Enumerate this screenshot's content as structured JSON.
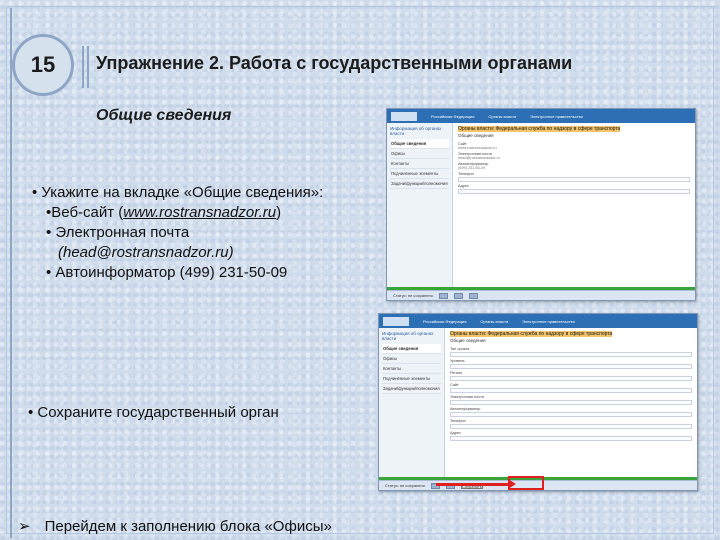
{
  "slide": {
    "number": "15",
    "title": "Упражнение 2. Работа с государственными органами",
    "subtitle": "Общие сведения",
    "bullet_main": "Укажите на вкладке «Общие сведения»:",
    "website_prefix": "Веб-сайт (",
    "website_url": "www.rostransnadzor.ru",
    "website_suffix": ")",
    "email_label": "Электронная почта",
    "email_value": "(head@rostransnadzor.ru)",
    "autoinformer": "Автоинформатор (499) 231-50-09",
    "save_bullet": "Сохраните государственный орган",
    "next_step": "Перейдем к заполнению блока «Офисы»"
  },
  "colors": {
    "accent_border": "#8ea6c6",
    "highlight_red": "#e02020",
    "portal_blue": "#2c6fb5",
    "portal_green": "#3aa33a"
  },
  "screenshot1": {
    "header_menu": [
      "Российская Федерация",
      "Органы власти",
      "Электронное правительство"
    ],
    "sidebar_head": "Информация об органах власти",
    "sidebar_items": [
      "Общие сведения",
      "Офисы",
      "Контакты",
      "Подчинённые элементы",
      "Задачи/функции/полномочия"
    ],
    "heading": "Органы власти: Федеральная служба по надзору в сфере транспорта",
    "tab": "Общие сведения",
    "fields": [
      {
        "label": "Сайт",
        "value": "www.rostransnadzor.ru"
      },
      {
        "label": "Электронная почта",
        "value": "head@rostransnadzor.ru"
      },
      {
        "label": "Автоинформатор",
        "value": "(499) 231-50-09"
      },
      {
        "label": "Телефон",
        "value": ""
      },
      {
        "label": "Адрес",
        "value": ""
      }
    ],
    "bottom_label": "Статус: не сохранено"
  },
  "screenshot2": {
    "header_menu": [
      "Российская Федерация",
      "Органы власти",
      "Электронное правительство"
    ],
    "sidebar_head": "Информация об органах власти",
    "sidebar_items": [
      "Общие сведения",
      "Офисы",
      "Контакты",
      "Подчинённые элементы",
      "Задачи/функции/полномочия"
    ],
    "heading": "Органы власти: Федеральная служба по надзору в сфере транспорта",
    "tab": "Общие сведения",
    "field_labels": [
      "Тип органа",
      "Уровень",
      "Регион",
      "Сайт",
      "Электронная почта",
      "Автоинформатор",
      "Телефон",
      "Адрес"
    ],
    "bottom_label": "Статус: не сохранено",
    "save_label": "Сохранить"
  }
}
